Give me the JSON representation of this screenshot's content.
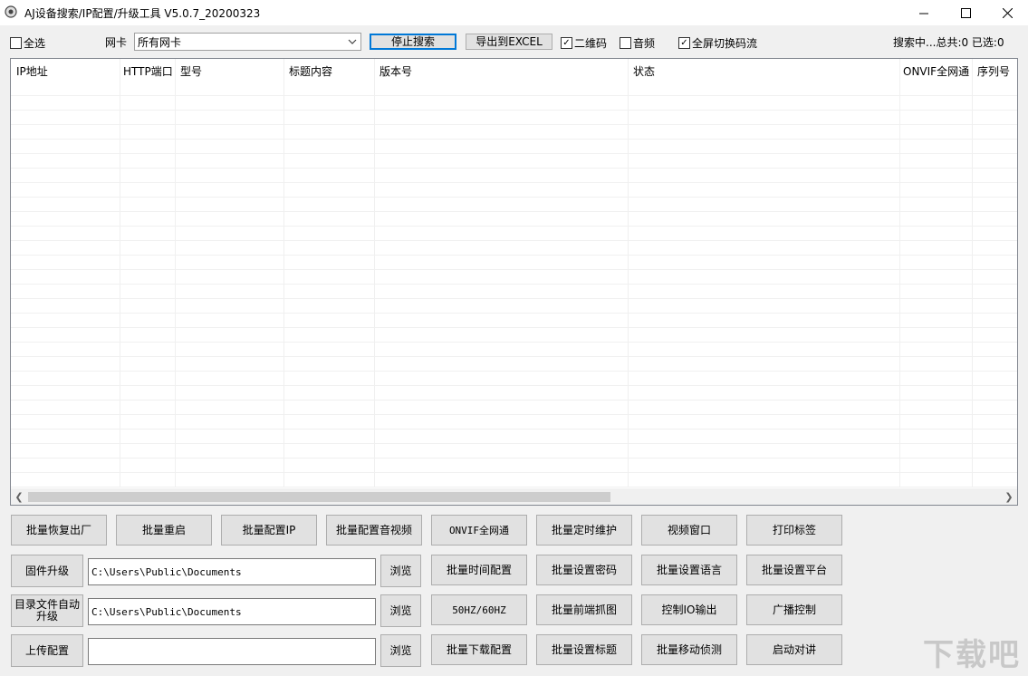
{
  "window": {
    "title": "AJ设备搜索/IP配置/升级工具 V5.0.7_20200323",
    "minimize": "—",
    "maximize": "☐",
    "close": "✕"
  },
  "toolbar": {
    "select_all": "全选",
    "nic_label": "网卡",
    "nic_value": "所有网卡",
    "stop_search": "停止搜索",
    "export_excel": "导出到EXCEL",
    "qrcode": "二维码",
    "audio": "音频",
    "fullscreen_switch": "全屏切换码流",
    "status": "搜索中...总共:0 已选:0"
  },
  "table": {
    "columns": [
      "IP地址",
      "HTTP端口",
      "型号",
      "标题内容",
      "版本号",
      "状态",
      "ONVIF全网通",
      "序列号"
    ],
    "rows": []
  },
  "buttons": {
    "row1": [
      "批量恢复出厂",
      "批量重启",
      "批量配置IP",
      "批量配置音视频",
      "ONVIF全网通",
      "批量定时维护",
      "视频窗口",
      "打印标签"
    ],
    "firmware_upgrade": "固件升级",
    "dir_auto_upgrade": "目录文件自动升级",
    "upload_config": "上传配置",
    "browse": "浏览",
    "col_a": [
      "批量时间配置",
      "50HZ/60HZ",
      "批量下载配置"
    ],
    "col_b": [
      "批量设置密码",
      "批量前端抓图",
      "批量设置标题"
    ],
    "col_c": [
      "批量设置语言",
      "控制IO输出",
      "批量移动侦测"
    ],
    "col_d": [
      "批量设置平台",
      "广播控制",
      "启动对讲"
    ]
  },
  "paths": {
    "firmware_path": "C:\\Users\\Public\\Documents",
    "dir_path": "C:\\Users\\Public\\Documents",
    "upload_path": ""
  },
  "watermark": "下载吧"
}
